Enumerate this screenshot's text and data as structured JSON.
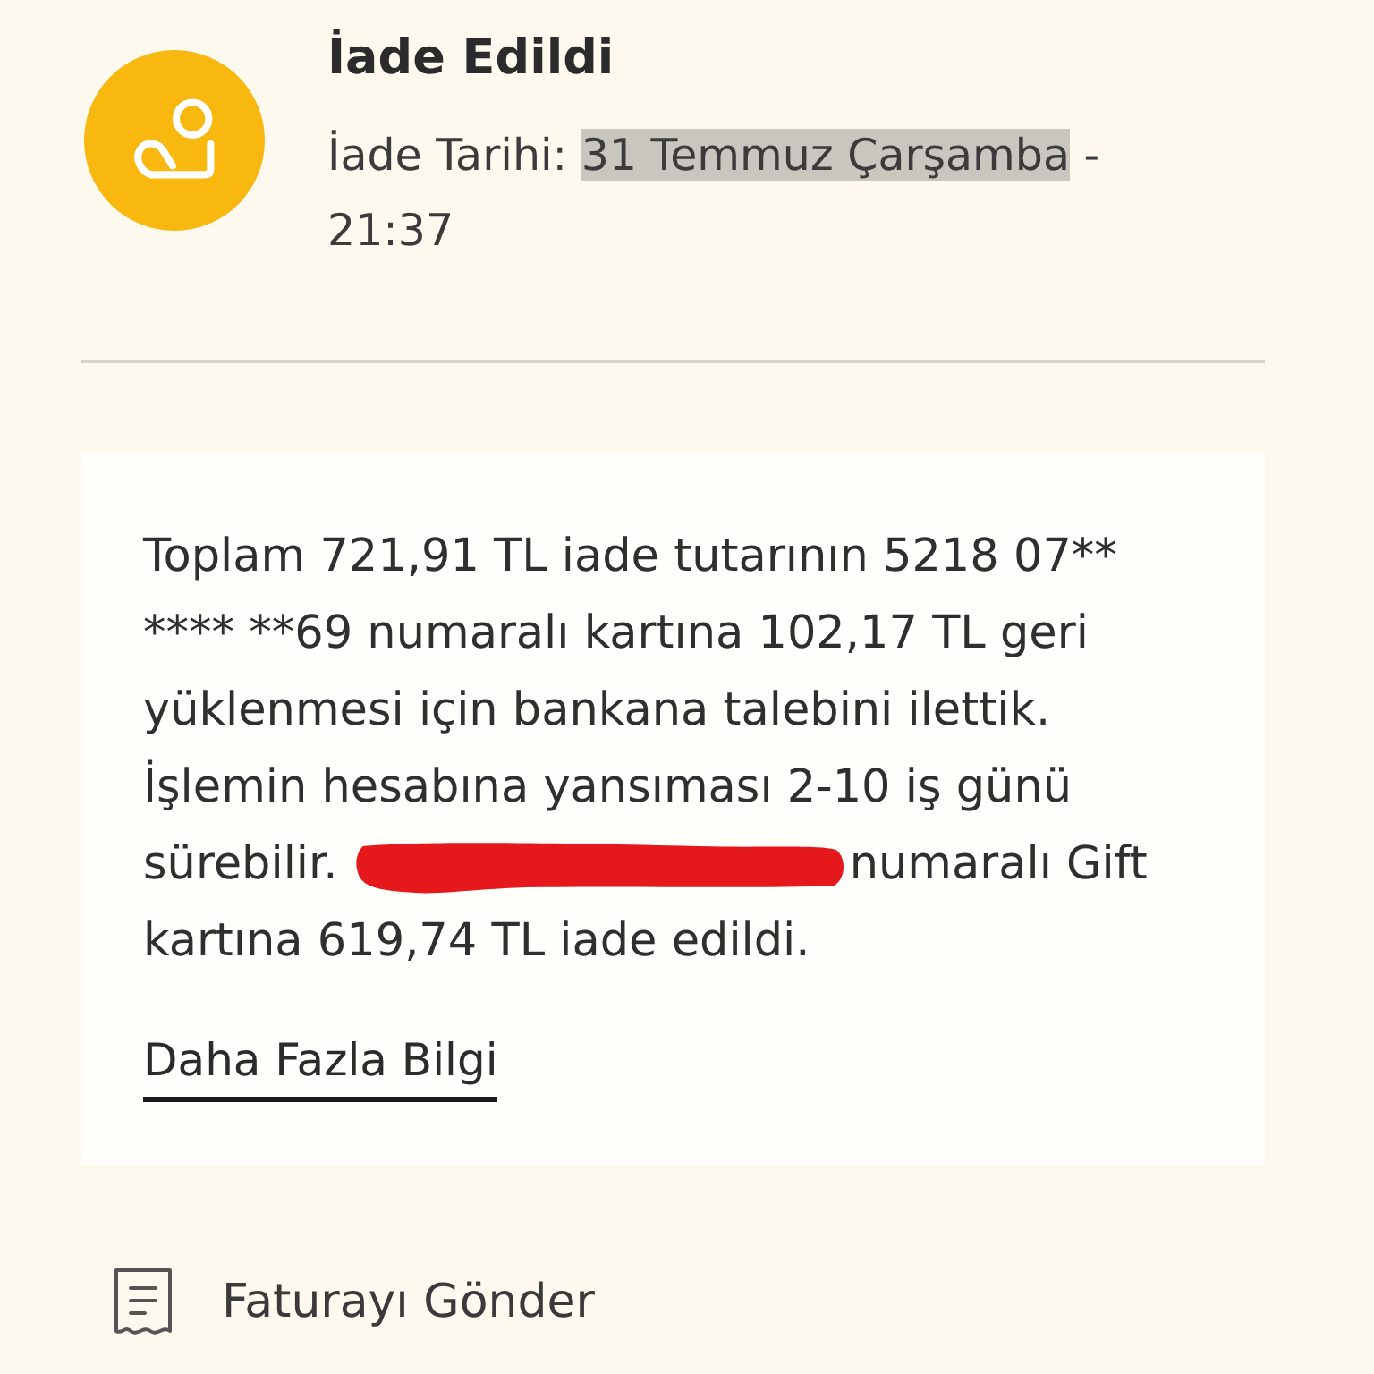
{
  "status": {
    "title": "İade Edildi",
    "date_label": "İade Tarihi:",
    "date": {
      "text": "31 Temmuz Çarşamba",
      "highlighted": true
    },
    "date_separator": "-",
    "time": "21:37"
  },
  "info_card": {
    "message_start": "Toplam 721,91 TL iade tutarının 5218 07** **** **69 numaralı kartına 102,17 TL geri yüklenmesi için bankana talebini ilettik. İşlemin hesabına yansıması 2-10 iş günü sürebilir.",
    "redacted": true,
    "message_end": "numaralı Gift kartına 619,74 TL iade edildi.",
    "link": "Daha Fazla Bilgi"
  },
  "actions": [
    {
      "label": "Faturayı Gönder"
    }
  ]
}
